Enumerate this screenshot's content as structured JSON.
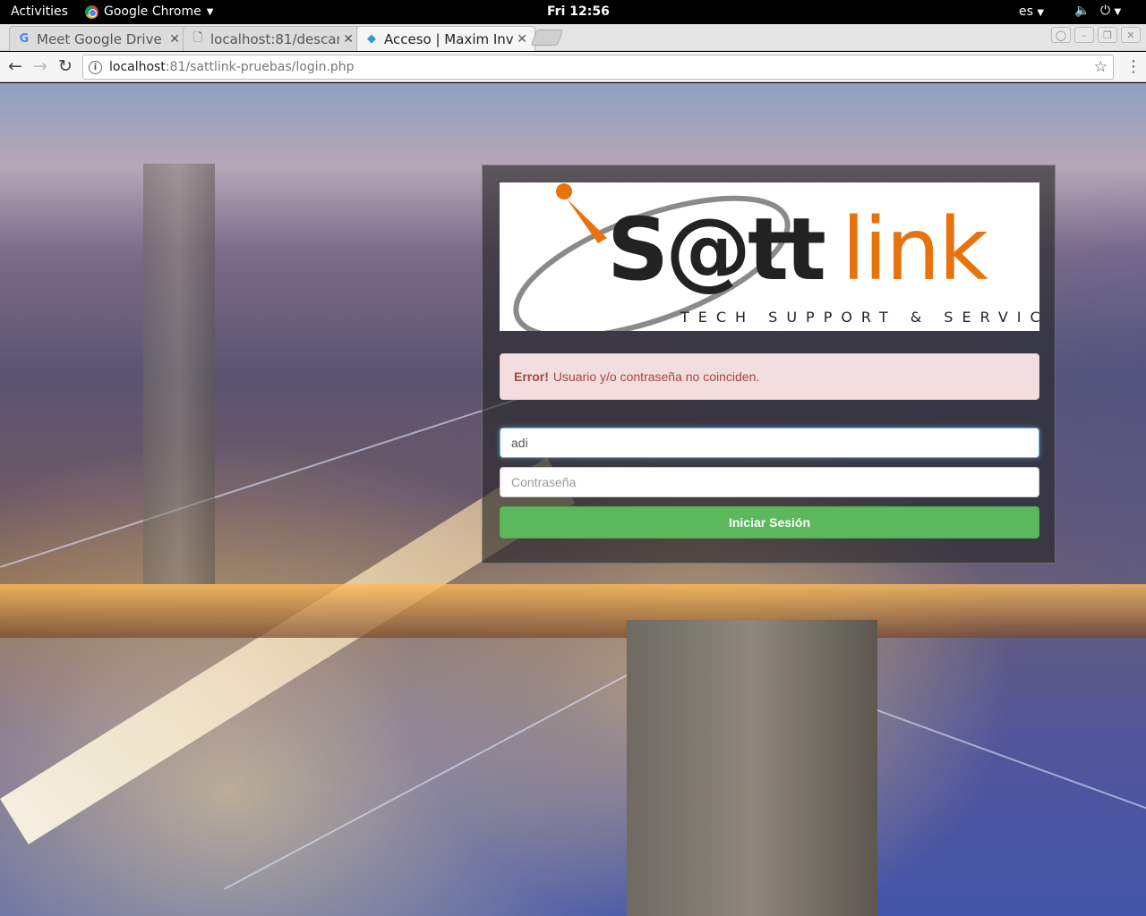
{
  "topbar": {
    "activities": "Activities",
    "app_name": "Google Chrome",
    "clock": "Fri 12:56",
    "language": "es"
  },
  "tabs": [
    {
      "title": "Meet Google Drive",
      "icon": "google-g-icon"
    },
    {
      "title": "localhost:81/descar",
      "icon": "page-icon"
    },
    {
      "title": "Acceso | Maxim Inv",
      "icon": "site-favicon",
      "active": true
    }
  ],
  "toolbar": {
    "url_host": "localhost",
    "url_rest": ":81/sattlink-pruebas/login.php"
  },
  "login": {
    "logo": {
      "brand_prefix": "S@tt",
      "brand_suffix": "link",
      "tagline": "TECH SUPPORT & SERVICE"
    },
    "alert": {
      "strong": "Error!",
      "message": "Usuario y/o contraseña no coinciden."
    },
    "username_value": "adi",
    "password_placeholder": "Contraseña",
    "submit_label": "Iniciar Sesión"
  },
  "colors": {
    "alert_bg": "#f2dede",
    "alert_text": "#a94442",
    "button": "#5cb85c",
    "logo_orange": "#e8720c"
  }
}
